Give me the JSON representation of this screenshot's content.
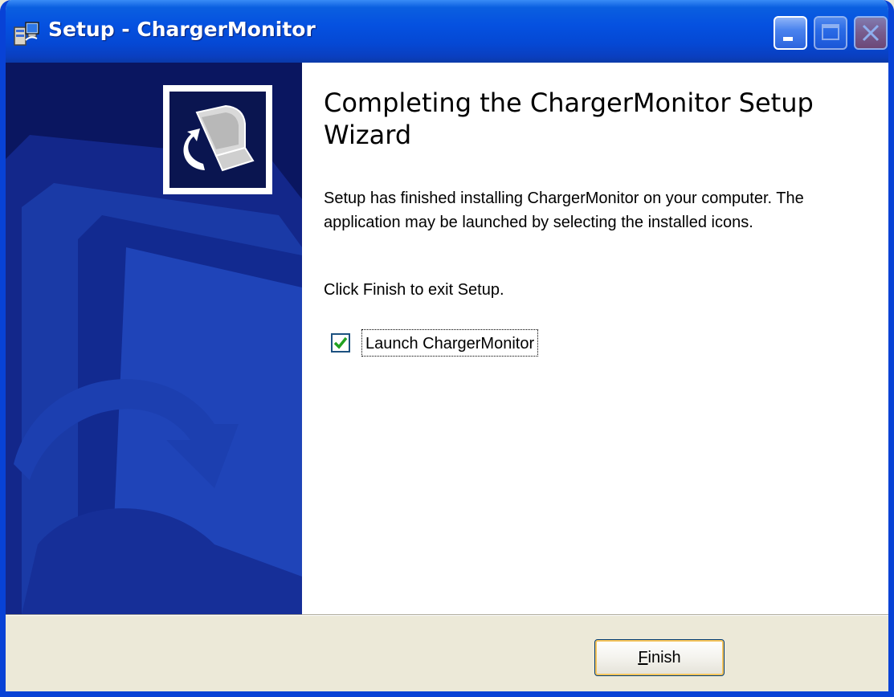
{
  "window": {
    "title": "Setup - ChargerMonitor",
    "controls": {
      "minimize_icon": "minimize-icon",
      "maximize_icon": "maximize-icon",
      "close_icon": "close-icon"
    }
  },
  "wizard": {
    "heading": "Completing the ChargerMonitor Setup Wizard",
    "description": "Setup has finished installing ChargerMonitor on your computer. The application may be launched by selecting the installed icons.",
    "instruction": "Click Finish to exit Setup.",
    "launch_checkbox": {
      "label": "Launch ChargerMonitor",
      "checked": true
    },
    "logo_icon": "setup-computer-icon"
  },
  "footer": {
    "finish_accel": "F",
    "finish_rest": "inish"
  },
  "colors": {
    "titlebar": "#0551e0",
    "side_panel": "#0a1560",
    "window_bg": "#ece9d8",
    "check_green": "#21a121"
  }
}
